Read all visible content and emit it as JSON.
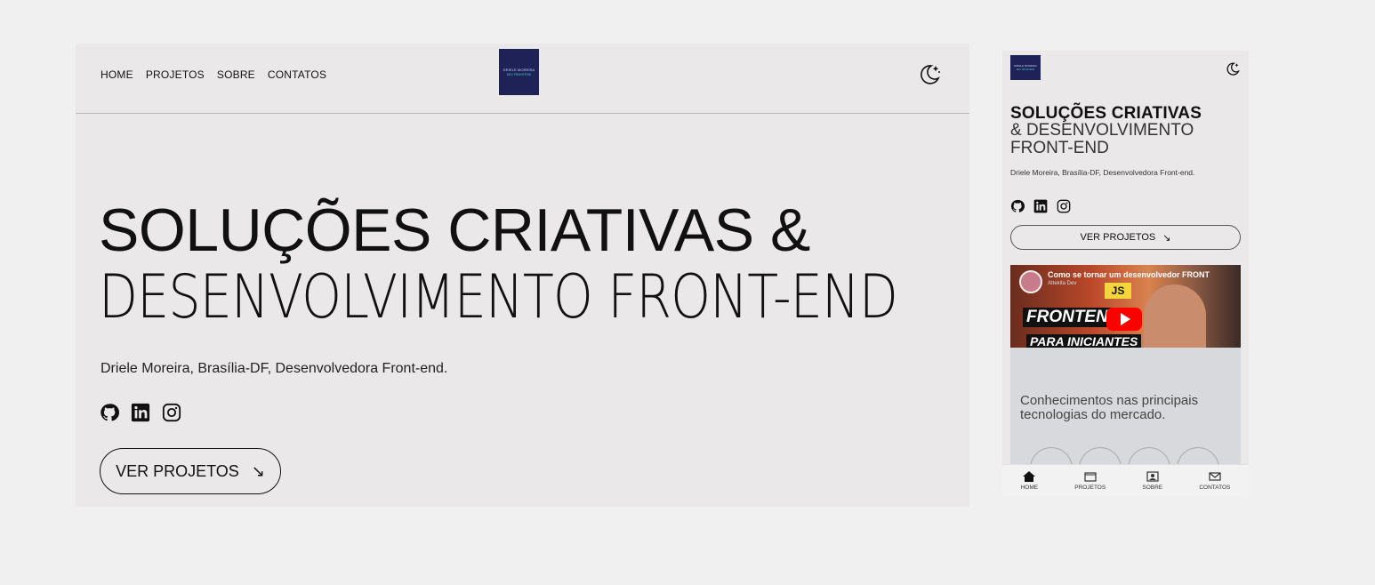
{
  "desktop": {
    "nav": [
      "HOME",
      "PROJETOS",
      "SOBRE",
      "CONTATOS"
    ],
    "logo": {
      "line1": "DRIELE MOREIRA",
      "line2": "DEV FRONTEND"
    },
    "theme_icon": "moon-stars-icon",
    "headline_line1": "SOLUÇÕES CRIATIVAS &",
    "headline_line2": "DESENVOLVIMENTO FRONT-END",
    "subtitle": "Driele Moreira, Brasília-DF, Desenvolvedora Front-end.",
    "socials": [
      "github-icon",
      "linkedin-icon",
      "instagram-icon"
    ],
    "cta_label": "VER PROJETOS",
    "cta_arrow": "↘"
  },
  "mobile": {
    "logo": {
      "line1": "DRIELE MOREIRA",
      "line2": "DEV FRONTEND"
    },
    "headline_line1": "SOLUÇÕES CRIATIVAS",
    "headline_line2": "& DESENVOLVIMENTO FRONT-END",
    "subtitle": "Driele Moreira, Brasília-DF, Desenvolvedora Front-end.",
    "cta_label": "VER PROJETOS",
    "cta_arrow": "↘",
    "video": {
      "title": "Como se tornar um desenvolvedor FRONT",
      "channel": "Attekita Dev",
      "badge_js": "JS",
      "text_front": "FRONTEND",
      "text_para": "PARA INICIANTES"
    },
    "skills_text": "Conhecimentos nas principais tecnologias do mercado.",
    "tabs": [
      "HOME",
      "PROJETOS",
      "SOBRE",
      "CONTATOS"
    ]
  }
}
